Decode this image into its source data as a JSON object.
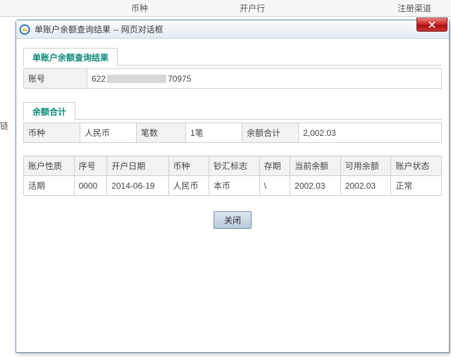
{
  "background": {
    "header_currency": "币种",
    "header_bank": "开户行",
    "header_channel": "注册渠道",
    "chain_text": "链"
  },
  "dialog": {
    "title": "单账户余额查询结果 -- 网页对话框"
  },
  "section_result": {
    "title": "单账户余额查询结果",
    "account_label": "账号",
    "account_value_prefix": "622",
    "account_value_suffix": "70975"
  },
  "section_balance": {
    "title": "余额合计",
    "col_currency": "币种",
    "val_currency": "人民币",
    "col_count": "笔数",
    "val_count": "1笔",
    "col_total": "余额合计",
    "val_total": "2,002.03"
  },
  "detail": {
    "headers": {
      "nature": "账户性质",
      "seq": "序号",
      "open_date": "开户日期",
      "currency": "币种",
      "notes_flag": "钞汇标志",
      "term": "存期",
      "current_balance": "当前余额",
      "avail_balance": "可用余额",
      "status": "账户状态"
    },
    "row": {
      "nature": "活期",
      "seq": "0000",
      "open_date": "2014-06-19",
      "currency": "人民币",
      "notes_flag": "本币",
      "term": "\\",
      "current_balance": "2002.03",
      "avail_balance": "2002.03",
      "status": "正常"
    }
  },
  "buttons": {
    "close": "关闭"
  }
}
